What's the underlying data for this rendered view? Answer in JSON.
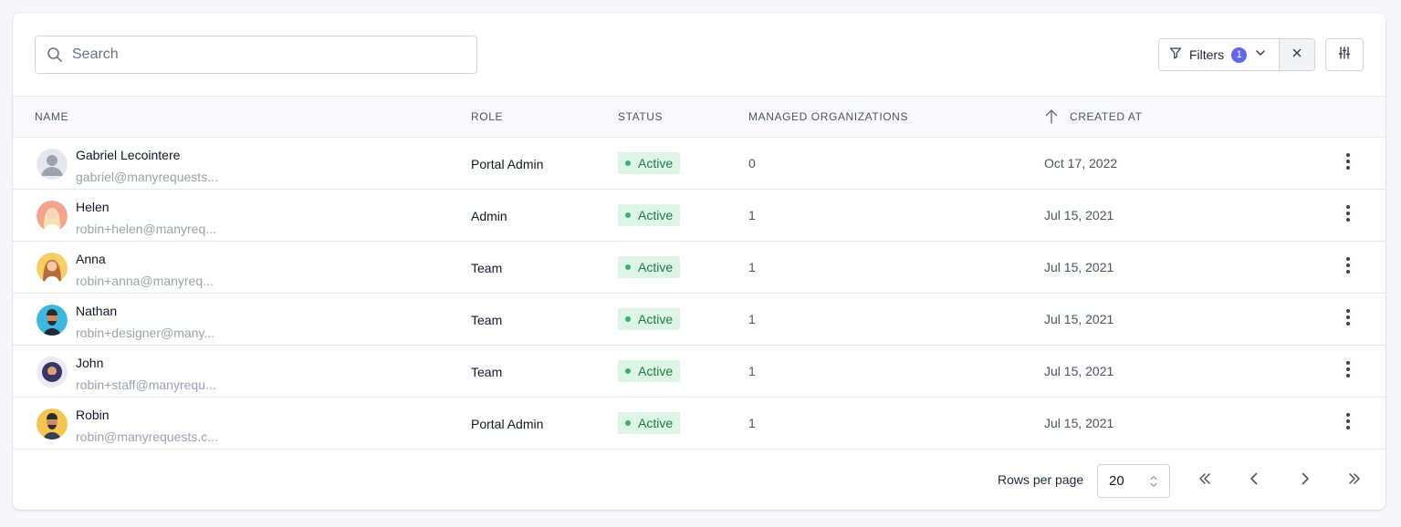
{
  "search": {
    "placeholder": "Search",
    "value": ""
  },
  "toolbar": {
    "filters_label": "Filters",
    "filters_count": "1"
  },
  "table": {
    "columns": [
      "NAME",
      "ROLE",
      "STATUS",
      "MANAGED ORGANIZATIONS",
      "CREATED AT"
    ],
    "sorted_column": "CREATED AT",
    "sort_direction": "ascending",
    "rows": [
      {
        "name": "Gabriel Lecointere",
        "email": "gabriel@manyrequests...",
        "role": "Portal Admin",
        "status": "Active",
        "orgs": "0",
        "created": "Oct 17, 2022",
        "avatar": "default-avatar"
      },
      {
        "name": "Helen",
        "email": "robin+helen@manyreq...",
        "role": "Admin",
        "status": "Active",
        "orgs": "1",
        "created": "Jul 15, 2021",
        "avatar": "photo"
      },
      {
        "name": "Anna",
        "email": "robin+anna@manyreq...",
        "role": "Team",
        "status": "Active",
        "orgs": "1",
        "created": "Jul 15, 2021",
        "avatar": "photo"
      },
      {
        "name": "Nathan",
        "email": "robin+designer@many...",
        "role": "Team",
        "status": "Active",
        "orgs": "1",
        "created": "Jul 15, 2021",
        "avatar": "photo"
      },
      {
        "name": "John",
        "email": "robin+staff@manyrequ...",
        "role": "Team",
        "status": "Active",
        "orgs": "1",
        "created": "Jul 15, 2021",
        "avatar": "photo"
      },
      {
        "name": "Robin",
        "email": "robin@manyrequests.c...",
        "role": "Portal Admin",
        "status": "Active",
        "orgs": "1",
        "created": "Jul 15, 2021",
        "avatar": "photo"
      }
    ]
  },
  "pagination": {
    "rows_per_page_label": "Rows per page",
    "rows_per_page_value": "20"
  },
  "colors": {
    "accent": "#6366f1",
    "status_active_bg": "#dcf5e5",
    "status_active_text": "#1f7a45",
    "status_active_dot": "#34b36a"
  }
}
